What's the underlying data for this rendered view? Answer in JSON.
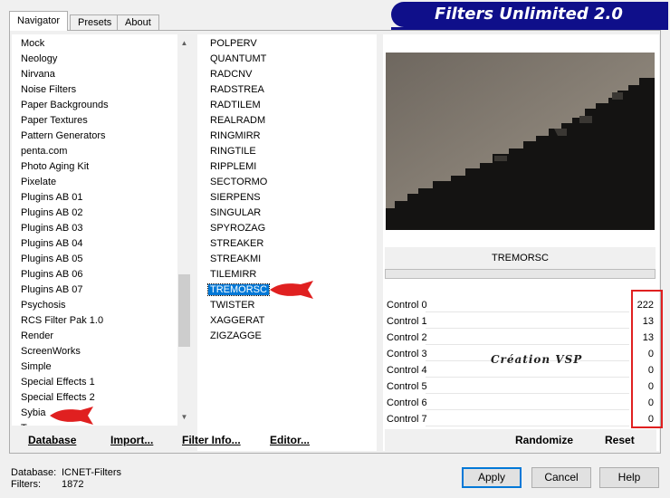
{
  "tabs": [
    "Navigator",
    "Presets",
    "About"
  ],
  "title": "Filters Unlimited 2.0",
  "categories": [
    "Mock",
    "Neology",
    "Nirvana",
    "Noise Filters",
    "Paper Backgrounds",
    "Paper Textures",
    "Pattern Generators",
    "penta.com",
    "Photo Aging Kit",
    "Pixelate",
    "Plugins AB 01",
    "Plugins AB 02",
    "Plugins AB 03",
    "Plugins AB 04",
    "Plugins AB 05",
    "Plugins AB 06",
    "Plugins AB 07",
    "Psychosis",
    "RCS Filter Pak 1.0",
    "Render",
    "ScreenWorks",
    "Simple",
    "Special Effects 1",
    "Special Effects 2",
    "Sybia",
    "Tramages"
  ],
  "filters": [
    "POLPERV",
    "QUANTUMT",
    "RADCNV",
    "RADSTREA",
    "RADTILEM",
    "REALRADM",
    "RINGMIRR",
    "RINGTILE",
    "RIPPLEMI",
    "SECTORMO",
    "SIERPENS",
    "SINGULAR",
    "SPYROZAG",
    "STREAKER",
    "STREAKMI",
    "TILEMIRR",
    "TREMORSC",
    "TWISTER",
    "XAGGERAT",
    "ZIGZAGGE"
  ],
  "selected_filter": "TREMORSC",
  "selected_category": "Sybia",
  "bottom_left": {
    "database": "Database",
    "import": "Import...",
    "filter_info": "Filter Info...",
    "editor": "Editor..."
  },
  "filter_name": "TREMORSC",
  "controls": [
    {
      "label": "Control 0",
      "value": "222"
    },
    {
      "label": "Control 1",
      "value": "13"
    },
    {
      "label": "Control 2",
      "value": "13"
    },
    {
      "label": "Control 3",
      "value": "0"
    },
    {
      "label": "Control 4",
      "value": "0"
    },
    {
      "label": "Control 5",
      "value": "0"
    },
    {
      "label": "Control 6",
      "value": "0"
    },
    {
      "label": "Control 7",
      "value": "0"
    }
  ],
  "watermark": "Création VSP",
  "right_bottom": {
    "randomize": "Randomize",
    "reset": "Reset"
  },
  "status": {
    "database_label": "Database:",
    "database_value": "ICNET-Filters",
    "filters_label": "Filters:",
    "filters_value": "1872"
  },
  "buttons": {
    "apply": "Apply",
    "cancel": "Cancel",
    "help": "Help"
  },
  "colors": {
    "banner": "#0f0f8a",
    "selection": "#0078d7",
    "arrow": "#e02020"
  }
}
